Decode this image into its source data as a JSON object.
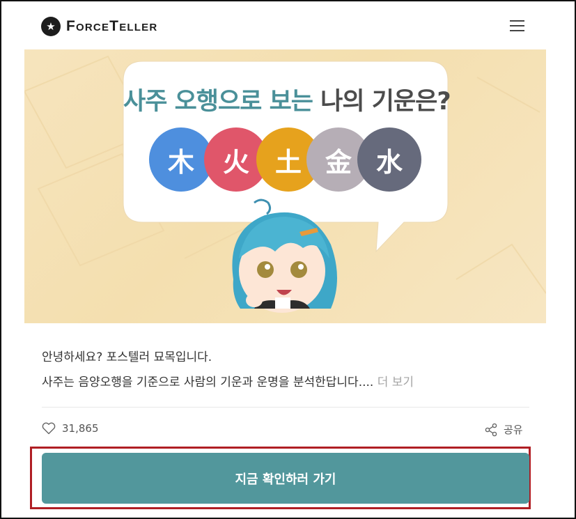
{
  "header": {
    "logo_text": "ForceTeller",
    "menu_icon": "hamburger-menu-icon"
  },
  "banner": {
    "title_highlight": "사주 오행으로 보는",
    "title_rest": " 나의 기운은?",
    "elements": [
      {
        "char": "木",
        "color": "#4e8fde"
      },
      {
        "char": "火",
        "color": "#e0566a"
      },
      {
        "char": "土",
        "color": "#e6a21d"
      },
      {
        "char": "金",
        "color": "#b6aeb6"
      },
      {
        "char": "水",
        "color": "#666a7c"
      }
    ]
  },
  "intro": {
    "line1": "안녕하세요? 포스텔러 묘목입니다.",
    "line2": "사주는 음양오행을 기준으로 사람의 기운과 운명을 분석한답니다.",
    "ellipsis": "...",
    "more_label": " 더 보기"
  },
  "stats": {
    "likes": "31,865",
    "share_label": "공유"
  },
  "cta": {
    "label": "지금 확인하러 가기",
    "color": "#52979c"
  }
}
